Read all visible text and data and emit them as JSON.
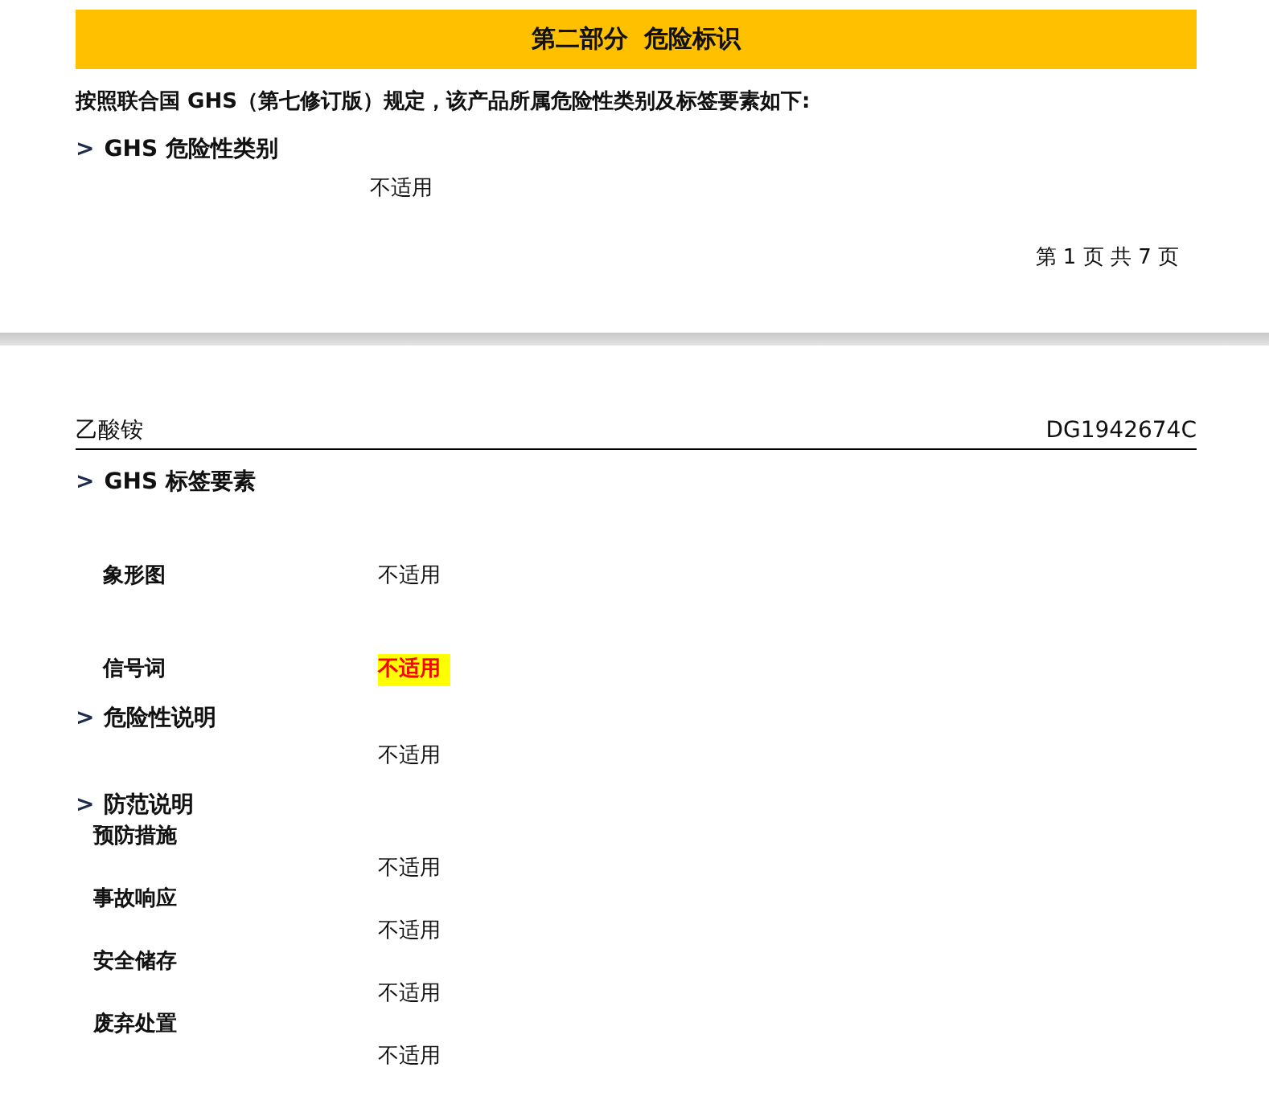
{
  "page_1": {
    "banner_title": "第二部分  危险标识",
    "intro": "按照联合国 GHS（第七修订版）规定，该产品所属危险性类别及标签要素如下:",
    "sections": [
      {
        "marker": ">",
        "title": "GHS 危险性类别",
        "rows": [
          {
            "kind": "plain",
            "value": "不适用",
            "highlighted": false
          }
        ]
      }
    ],
    "page_number": "第 1 页  共 7 页"
  },
  "page_2": {
    "header": {
      "product": "乙酸铵",
      "code": "DG1942674C"
    },
    "sections": [
      {
        "marker": ">",
        "title": "GHS 标签要素",
        "rows": [
          {
            "kind": "inline",
            "label": "象形图",
            "value": "不适用",
            "highlighted": false
          },
          {
            "kind": "inline",
            "label": "信号词",
            "value": "不适用",
            "highlighted": true
          }
        ]
      },
      {
        "marker": ">",
        "title": "危险性说明",
        "rows": [
          {
            "kind": "plain",
            "value": "不适用",
            "highlighted": false
          }
        ]
      },
      {
        "marker": ">",
        "title": "防范说明",
        "rows": [
          {
            "kind": "stacked",
            "label": "预防措施",
            "value": "不适用",
            "highlighted": false
          },
          {
            "kind": "stacked",
            "label": "事故响应",
            "value": "不适用",
            "highlighted": false
          },
          {
            "kind": "stacked",
            "label": "安全储存",
            "value": "不适用",
            "highlighted": false
          },
          {
            "kind": "stacked",
            "label": "废弃处置",
            "value": "不适用",
            "highlighted": false
          }
        ]
      }
    ]
  }
}
